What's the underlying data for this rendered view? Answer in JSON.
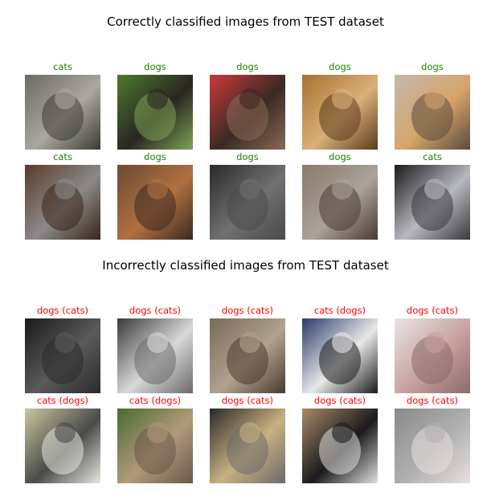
{
  "correct_section": {
    "title": "Correctly classified images from TEST dataset",
    "rows": [
      [
        {
          "label": "cats",
          "photo": "tabby-cat-photo",
          "colors": [
            "#6b6a63",
            "#a9a79f",
            "#3b3a36"
          ]
        },
        {
          "label": "dogs",
          "photo": "german-shepherd-on-grass-photo",
          "colors": [
            "#4d7a2e",
            "#2a2622",
            "#7fa255"
          ]
        },
        {
          "label": "dogs",
          "photo": "person-holding-small-dog-photo",
          "colors": [
            "#c93a3a",
            "#3a2a24",
            "#8a6a58"
          ]
        },
        {
          "label": "dogs",
          "photo": "poodle-in-dog-bed-photo",
          "colors": [
            "#a8722e",
            "#d9b07a",
            "#5a3a1c"
          ]
        },
        {
          "label": "dogs",
          "photo": "tan-dog-on-couch-photo",
          "colors": [
            "#c2b9ad",
            "#d6a46a",
            "#5a4a3e"
          ]
        }
      ],
      [
        {
          "label": "cats",
          "photo": "fluffy-cat-on-floor-photo",
          "colors": [
            "#5a3a2a",
            "#8a8a8a",
            "#3a2418"
          ]
        },
        {
          "label": "dogs",
          "photo": "brown-dog-on-floor-photo",
          "colors": [
            "#6a4a34",
            "#b07040",
            "#3a2a20"
          ]
        },
        {
          "label": "dogs",
          "photo": "black-shaggy-dog-in-car-photo",
          "colors": [
            "#2a2a2a",
            "#707070",
            "#4a4a4a"
          ]
        },
        {
          "label": "dogs",
          "photo": "small-dog-on-leash-photo",
          "colors": [
            "#8a7a6a",
            "#aaa29a",
            "#4a3a34"
          ]
        },
        {
          "label": "cats",
          "photo": "black-cat-sitting-photo",
          "colors": [
            "#1a1a1a",
            "#b8b8c0",
            "#3a3a3a"
          ]
        }
      ]
    ]
  },
  "incorrect_section": {
    "title": "Incorrectly classified images from TEST dataset",
    "rows": [
      [
        {
          "label": "dogs (cats)",
          "photo": "black-cat-standing-photo",
          "colors": [
            "#1a1a1a",
            "#5a5a5a",
            "#2a2a2a"
          ]
        },
        {
          "label": "dogs (cats)",
          "photo": "tabby-white-cat-lying-photo",
          "colors": [
            "#3a3a3a",
            "#d8d8d8",
            "#6a6a6a"
          ]
        },
        {
          "label": "dogs (cats)",
          "photo": "tabby-cat-sleeping-photo",
          "colors": [
            "#7a6a58",
            "#b0a290",
            "#4a3a2e"
          ]
        },
        {
          "label": "cats (dogs)",
          "photo": "black-white-puppy-held-photo",
          "colors": [
            "#2a3a6a",
            "#e8e8e8",
            "#1a1a1a"
          ]
        },
        {
          "label": "dogs (cats)",
          "photo": "white-cat-closeup-photo",
          "colors": [
            "#e8e4e4",
            "#c8a0a0",
            "#8a6a6a"
          ]
        }
      ],
      [
        {
          "label": "cats (dogs)",
          "photo": "pitbull-sitting-photo",
          "colors": [
            "#c8c8a0",
            "#4a4a4a",
            "#e8e8e0"
          ]
        },
        {
          "label": "cats (dogs)",
          "photo": "tan-dog-by-fence-photo",
          "colors": [
            "#4a6a34",
            "#b09a7a",
            "#6a5a4a"
          ]
        },
        {
          "label": "dogs (cats)",
          "photo": "cat-behind-cage-bars-photo",
          "colors": [
            "#2a2a2a",
            "#c8b080",
            "#6a6a6a"
          ]
        },
        {
          "label": "dogs (cats)",
          "photo": "black-white-cat-in-basket-photo",
          "colors": [
            "#a88a6a",
            "#1a1a1a",
            "#e0e0e0"
          ]
        },
        {
          "label": "dogs (cats)",
          "photo": "gray-cat-on-bed-photo",
          "colors": [
            "#8a8a8a",
            "#b0b0b0",
            "#e8e0e0"
          ]
        }
      ]
    ]
  }
}
